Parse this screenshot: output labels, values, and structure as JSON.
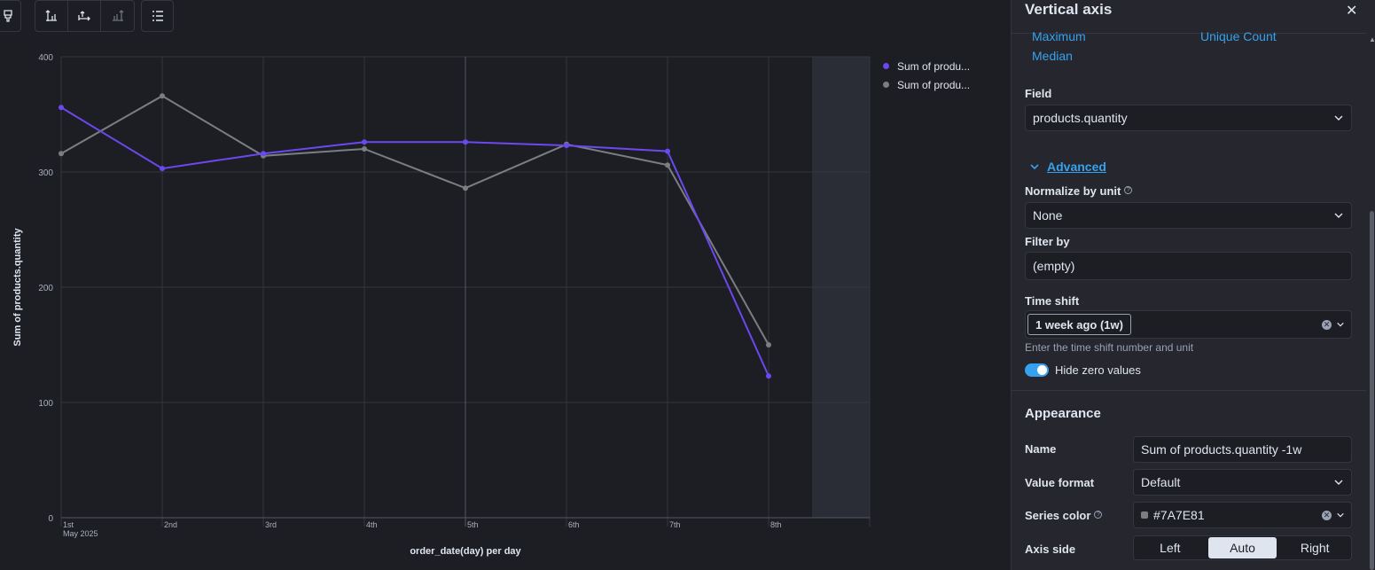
{
  "toolbar": {
    "icons": [
      "brush-icon",
      "left-axis-icon",
      "bottom-axis-icon",
      "right-axis-icon",
      "legend-icon"
    ]
  },
  "chart_data": {
    "type": "line",
    "categories": [
      "1st",
      "2nd",
      "3rd",
      "4th",
      "5th",
      "6th",
      "7th",
      "8th"
    ],
    "category_sublabel": "May 2025",
    "series": [
      {
        "name": "Sum of produ...",
        "color": "#6c48f0",
        "values": [
          356,
          303,
          316,
          326,
          326,
          323,
          318,
          123
        ]
      },
      {
        "name": "Sum of produ...",
        "color": "#7A7E81",
        "values": [
          316,
          366,
          314,
          320,
          286,
          324,
          306,
          150
        ]
      }
    ],
    "xlabel": "order_date(day) per day",
    "ylabel": "Sum of products.quantity",
    "yticks": [
      "0",
      "100",
      "200",
      "300",
      "400"
    ],
    "ylim": [
      0,
      400
    ],
    "grid": true,
    "legend_position": "top-right"
  },
  "flyout": {
    "title": "Vertical axis",
    "functions": [
      "Maximum",
      "Unique Count",
      "Median"
    ],
    "field_label": "Field",
    "field_value": "products.quantity",
    "advanced_label": "Advanced",
    "normalize_label": "Normalize by unit",
    "normalize_value": "None",
    "filter_label": "Filter by",
    "filter_value": "(empty)",
    "timeshift_label": "Time shift",
    "timeshift_value": "1 week ago (1w)",
    "timeshift_hint": "Enter the time shift number and unit",
    "hide_zero_label": "Hide zero values",
    "appearance_title": "Appearance",
    "name_label": "Name",
    "name_value": "Sum of products.quantity -1w",
    "value_format_label": "Value format",
    "value_format_value": "Default",
    "series_color_label": "Series color",
    "series_color_value": "#7A7E81",
    "axis_side_label": "Axis side",
    "axis_side_options": [
      "Left",
      "Auto",
      "Right"
    ],
    "axis_side_selected": "Auto"
  }
}
